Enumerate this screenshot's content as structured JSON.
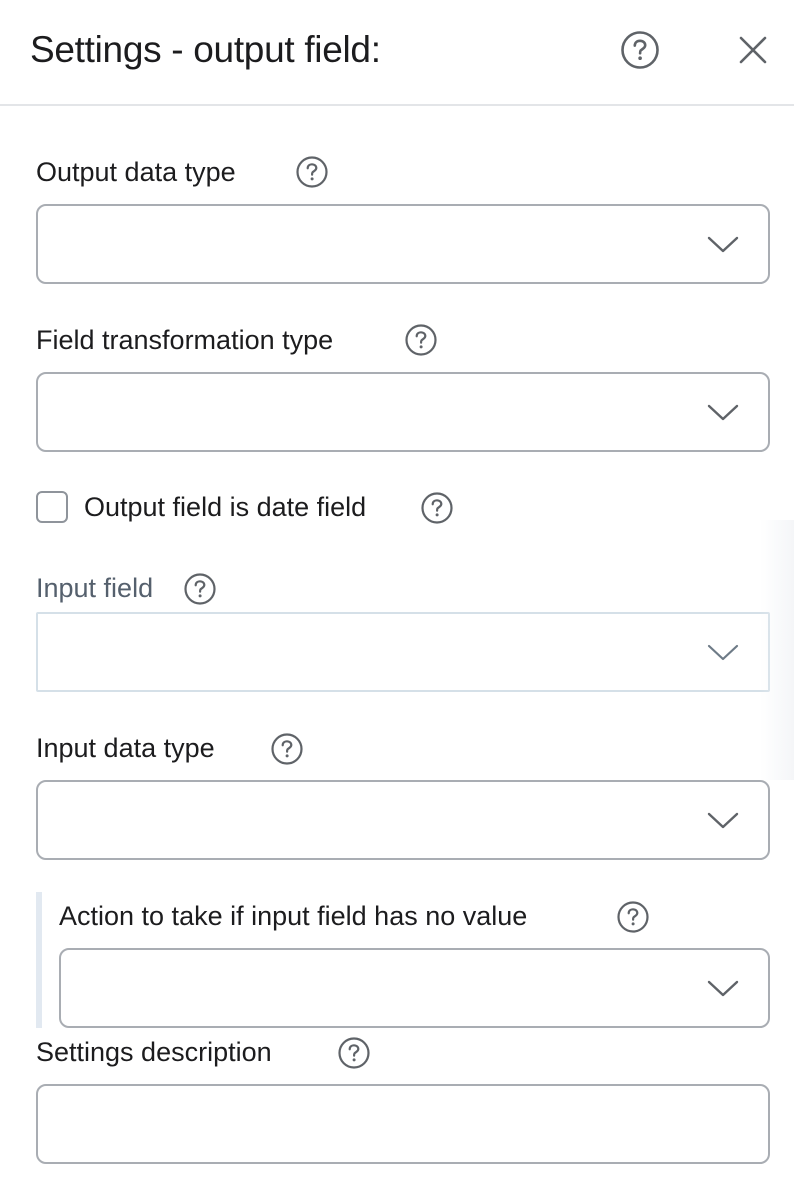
{
  "header": {
    "title": "Settings - output field:",
    "help_icon": "question-circle-icon",
    "close_icon": "close-icon"
  },
  "fields": {
    "output_data_type": {
      "label": "Output data type",
      "value": ""
    },
    "field_transformation_type": {
      "label": "Field transformation type",
      "value": ""
    },
    "output_is_date": {
      "label": "Output field is date field",
      "checked": false
    },
    "input_field": {
      "label": "Input field",
      "value": "",
      "disabled": true
    },
    "input_data_type": {
      "label": "Input data type",
      "value": ""
    },
    "no_value_action": {
      "label": "Action to take if input field has no value",
      "value": ""
    },
    "settings_description": {
      "label": "Settings description",
      "value": ""
    }
  },
  "colors": {
    "text": "#1c1c1e",
    "muted_text": "#55606d",
    "border": "#a9adb3",
    "disabled_border": "#d5e0e8",
    "icon": "#5f6368"
  }
}
